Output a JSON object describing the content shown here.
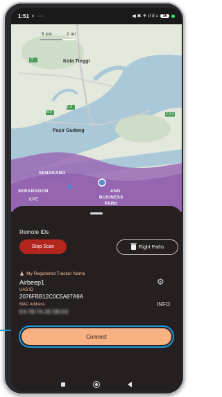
{
  "status_bar": {
    "time": "1:51",
    "left_icons": "◐ ···",
    "right_icons": "◀ ✱ ⚘ ıl ıl ≈",
    "battery": "56"
  },
  "map": {
    "scale_left": "5 km",
    "scale_right": "2 mi",
    "labels": {
      "kota_tinggi": "Kota Tinggi",
      "pasir_gudang": "Pasir Gudang",
      "sengkang": "SENGKANG",
      "serangoon": "SERANGOON",
      "ang": "ANG",
      "business": "BUSINESS",
      "park": "PARK",
      "road_1": "3",
      "road_2": "E3",
      "road_3": "E2",
      "road_4": "E22",
      "road_5": "KPE"
    }
  },
  "sheet": {
    "remote_title": "Remote IDs",
    "stop_scan": "Stop Scan",
    "flight_paths": "Flight Paths",
    "registered_label": "My Registered Tracker Name",
    "device_name": "Airbeep1",
    "uas_id_label": "UAS ID",
    "uas_id_value": "2076FBB12C0C5A87A9A",
    "mac_label": "MAC Address",
    "mac_value": "E4:7B:7A:2E:5B:D3",
    "info": "INFO",
    "connect": "Connect"
  },
  "colors": {
    "accent_blue": "#1f9de0",
    "connect_bg": "#f7b183",
    "stop_bg": "#b3261e",
    "sheet_bg": "#251f1f",
    "label_orange": "#f5c19c"
  }
}
